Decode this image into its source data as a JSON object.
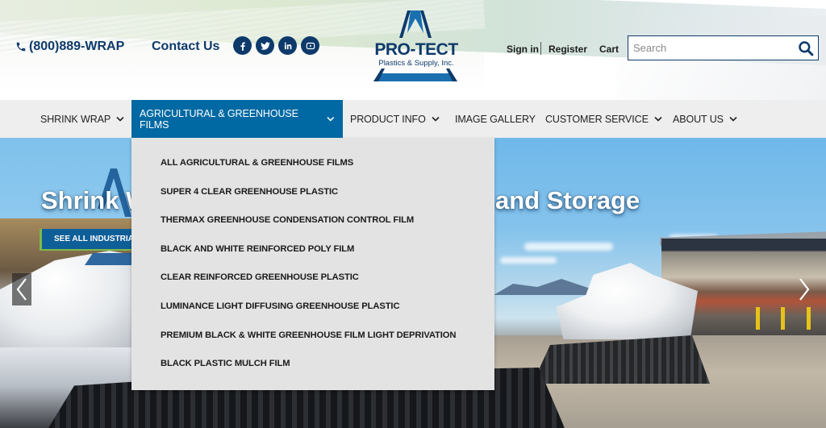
{
  "header": {
    "phone": "(800)889-WRAP",
    "contact_label": "Contact Us",
    "social": [
      {
        "name": "facebook-icon",
        "glyph": "f"
      },
      {
        "name": "twitter-icon",
        "glyph": ""
      },
      {
        "name": "linkedin-icon",
        "glyph": "in"
      },
      {
        "name": "youtube-icon",
        "glyph": ""
      }
    ],
    "logo": {
      "brand": "PRO-TECT",
      "subtitle": "Plastics & Supply, Inc."
    },
    "sign_in": "Sign in",
    "register": "Register",
    "cart": "Cart",
    "search": {
      "placeholder": "Search",
      "value": ""
    }
  },
  "nav": {
    "items": [
      {
        "label": "SHRINK WRAP",
        "has_dropdown": true,
        "active": false
      },
      {
        "label": "AGRICULTURAL & GREENHOUSE FILMS",
        "has_dropdown": true,
        "active": true
      },
      {
        "label": "PRODUCT INFO",
        "has_dropdown": true,
        "active": false
      },
      {
        "label": "IMAGE GALLERY",
        "has_dropdown": false,
        "active": false
      },
      {
        "label": "CUSTOMER SERVICE",
        "has_dropdown": true,
        "active": false
      },
      {
        "label": "ABOUT US",
        "has_dropdown": true,
        "active": false
      }
    ]
  },
  "dropdown": {
    "items": [
      "ALL AGRICULTURAL & GREENHOUSE FILMS",
      "SUPER 4 CLEAR GREENHOUSE PLASTIC",
      "THERMAX GREENHOUSE CONDENSATION CONTROL FILM",
      "BLACK AND WHITE REINFORCED POLY FILM",
      "CLEAR REINFORCED GREENHOUSE PLASTIC",
      "LUMINANCE LIGHT DIFFUSING GREENHOUSE PLASTIC",
      "PREMIUM BLACK & WHITE GREENHOUSE FILM LIGHT DEPRIVATION",
      "BLACK PLASTIC MULCH FILM"
    ]
  },
  "hero": {
    "title_left_visible": "Shrink W",
    "title_right_visible": "and Storage",
    "cta_label": "SEE ALL INDUSTRIAL",
    "prev_icon": "chevron-left-icon",
    "next_icon": "chevron-right-icon"
  },
  "colors": {
    "brand_navy": "#0e3a6b",
    "nav_active": "#0069a3",
    "nav_bg": "#eeeeee",
    "dropdown_bg": "#e3e3e3",
    "cta_bg": "#0e5e98",
    "cta_accent": "#7fb94a"
  }
}
